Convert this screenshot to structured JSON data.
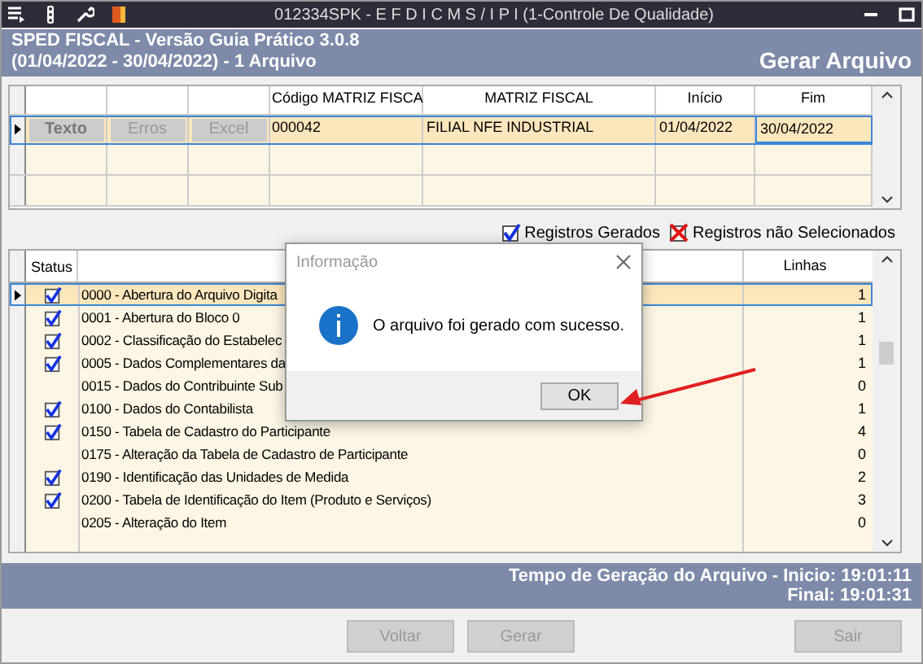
{
  "window": {
    "title": "012334SPK - E F D  I C M S / I P I (1-Controle De Qualidade)"
  },
  "header": {
    "line_1": "SPED FISCAL - Versão Guia Prático 3.0.8",
    "line_2": "(01/04/2022 - 30/04/2022) - 1 Arquivo",
    "action": "Gerar Arquivo"
  },
  "file_grid": {
    "columns": [
      "Código MATRIZ FISCA",
      "MATRIZ FISCAL",
      "Início",
      "Fim"
    ],
    "rows": [
      {
        "selected": true,
        "buttons": [
          {
            "label": "Texto",
            "disabled": false
          },
          {
            "label": "Erros",
            "disabled": true
          },
          {
            "label": "Excel",
            "disabled": true
          }
        ],
        "cells": [
          "000042",
          "FILIAL NFE INDUSTRIAL",
          "01/04/2022",
          "30/04/2022"
        ]
      }
    ]
  },
  "legend": [
    {
      "kind": "check",
      "label": "Registros Gerados"
    },
    {
      "kind": "cross",
      "label": "Registros não Selecionados"
    }
  ],
  "records": {
    "columns": [
      "Status",
      "Linhas"
    ],
    "rows": [
      {
        "checked": true,
        "selected": true,
        "description": "0000 - Abertura do Arquivo Digita",
        "lines": "1"
      },
      {
        "checked": true,
        "selected": false,
        "description": "0001 - Abertura do Bloco 0",
        "lines": "1"
      },
      {
        "checked": true,
        "selected": false,
        "description": "0002 - Classificação do Estabelec",
        "lines": "1"
      },
      {
        "checked": true,
        "selected": false,
        "description": "0005 - Dados Complementares da",
        "lines": "1"
      },
      {
        "checked": false,
        "selected": false,
        "description": "0015 - Dados do Contribuinte Sub",
        "lines": "0"
      },
      {
        "checked": true,
        "selected": false,
        "description": "0100 - Dados do Contabilista",
        "lines": "1"
      },
      {
        "checked": true,
        "selected": false,
        "description": "0150 - Tabela de Cadastro do Participante",
        "lines": "4"
      },
      {
        "checked": false,
        "selected": false,
        "description": "0175 - Alteração da Tabela de Cadastro de Participante",
        "lines": "0"
      },
      {
        "checked": true,
        "selected": false,
        "description": "0190 - Identificação das Unidades de Medida",
        "lines": "2"
      },
      {
        "checked": true,
        "selected": false,
        "description": "0200 - Tabela de Identificação do Item (Produto e Serviços)",
        "lines": "3"
      },
      {
        "checked": false,
        "selected": false,
        "description": "0205 - Alteração do Item",
        "lines": "0"
      }
    ]
  },
  "status_band": {
    "line_1": "Tempo de Geração do Arquivo - Inicio: 19:01:11",
    "line_2": "Final: 19:01:31"
  },
  "buttons": [
    {
      "label": "Voltar",
      "disabled": true
    },
    {
      "label": "Gerar",
      "disabled": true
    },
    {
      "label": "Sair",
      "disabled": true
    }
  ],
  "dialog": {
    "title": "Informação",
    "message": "O arquivo  foi gerado com sucesso.",
    "button": "OK"
  }
}
